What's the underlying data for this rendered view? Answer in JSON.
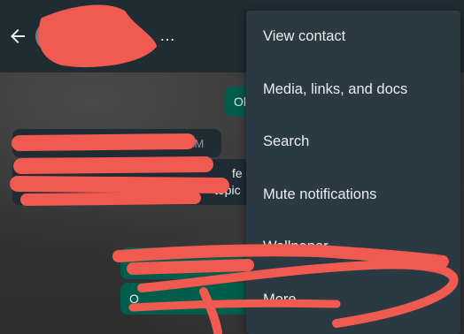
{
  "header": {
    "contact_name": "…",
    "back_icon": "back-arrow-icon"
  },
  "messages": {
    "outgoing_top_fragment": "Ol",
    "incoming_time": "4 PM",
    "incoming_frag_1": "fe",
    "incoming_frag_2": "topic",
    "outgoing_bottom_fragment": "O"
  },
  "menu": {
    "items": [
      {
        "label": "View contact"
      },
      {
        "label": "Media, links, and docs"
      },
      {
        "label": "Search"
      },
      {
        "label": "Mute notifications"
      },
      {
        "label": "Wallpaper"
      },
      {
        "label": "More",
        "submenu_icon": "chevron-right-icon"
      }
    ]
  },
  "colors": {
    "menu_bg": "#2a3942",
    "header_bg": "#1f2c33",
    "outgoing_bubble": "#005c4b",
    "incoming_bubble": "#1f2c33",
    "redaction": "#f05a50"
  }
}
